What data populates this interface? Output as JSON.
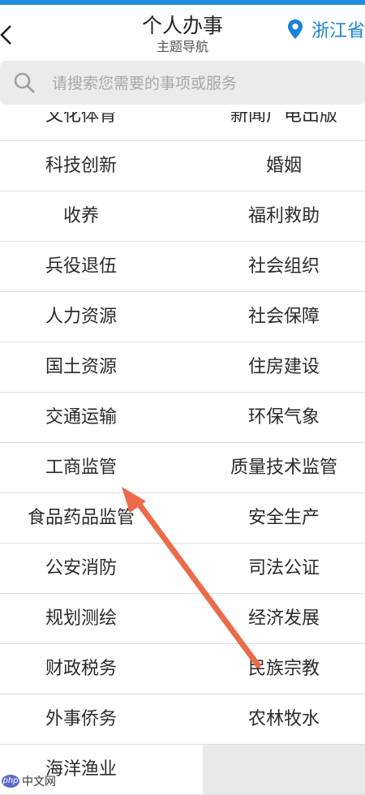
{
  "header": {
    "title": "个人办事",
    "subtitle": "主题导航",
    "location": "浙江省"
  },
  "search": {
    "placeholder": "请搜索您需要的事项或服务"
  },
  "topics": [
    {
      "left": "文化体育",
      "right": "新闻广电出版"
    },
    {
      "left": "科技创新",
      "right": "婚姻"
    },
    {
      "left": "收养",
      "right": "福利救助"
    },
    {
      "left": "兵役退伍",
      "right": "社会组织"
    },
    {
      "left": "人力资源",
      "right": "社会保障"
    },
    {
      "left": "国土资源",
      "right": "住房建设"
    },
    {
      "left": "交通运输",
      "right": "环保气象"
    },
    {
      "left": "工商监管",
      "right": "质量技术监管"
    },
    {
      "left": "食品药品监管",
      "right": "安全生产"
    },
    {
      "left": "公安消防",
      "right": "司法公证"
    },
    {
      "left": "规划测绘",
      "right": "经济发展"
    },
    {
      "left": "财政税务",
      "right": "民族宗教"
    },
    {
      "left": "外事侨务",
      "right": "农林牧水"
    },
    {
      "left": "海洋渔业",
      "right": ""
    }
  ],
  "watermark": {
    "logo": "php",
    "site": "中文网"
  },
  "colors": {
    "accent": "#1e8de0",
    "location_text": "#1a82d6",
    "arrow": "#ea6a4a"
  },
  "icons": {
    "back": "back-chevron-icon",
    "location": "location-pin-icon",
    "search": "search-icon"
  }
}
